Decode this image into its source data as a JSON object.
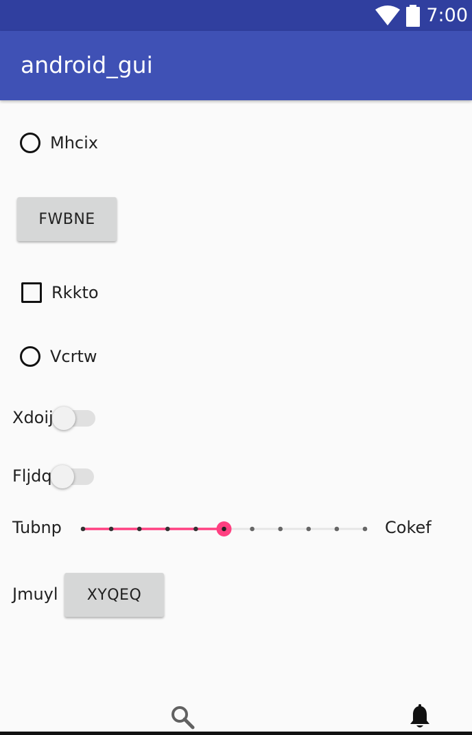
{
  "status_bar": {
    "time": "7:00",
    "wifi_icon": "wifi-icon",
    "battery_icon": "battery-icon"
  },
  "app_bar": {
    "title": "android_gui"
  },
  "controls": {
    "radio_1": {
      "label": "Mhcix",
      "checked": false
    },
    "button_1": {
      "label": "FWBNE"
    },
    "checkbox_1": {
      "label": "Rkkto",
      "checked": false
    },
    "radio_2": {
      "label": "Vcrtw",
      "checked": false
    },
    "switch_1": {
      "label": "Xdoij",
      "on": false
    },
    "switch_2": {
      "label": "Fljdq",
      "on": false
    },
    "slider": {
      "start_label": "Tubnp",
      "end_label": "Cokef",
      "steps": 10,
      "value": 5
    },
    "button_row": {
      "label": "Jmuyl",
      "button_label": "XYQEQ"
    }
  },
  "bottom_nav": {
    "search_icon": "search-icon",
    "bell_icon": "bell-icon"
  },
  "colors": {
    "status_bar": "#303f9f",
    "app_bar": "#3f51b5",
    "accent": "#ff4081",
    "button": "#d6d7d7"
  }
}
